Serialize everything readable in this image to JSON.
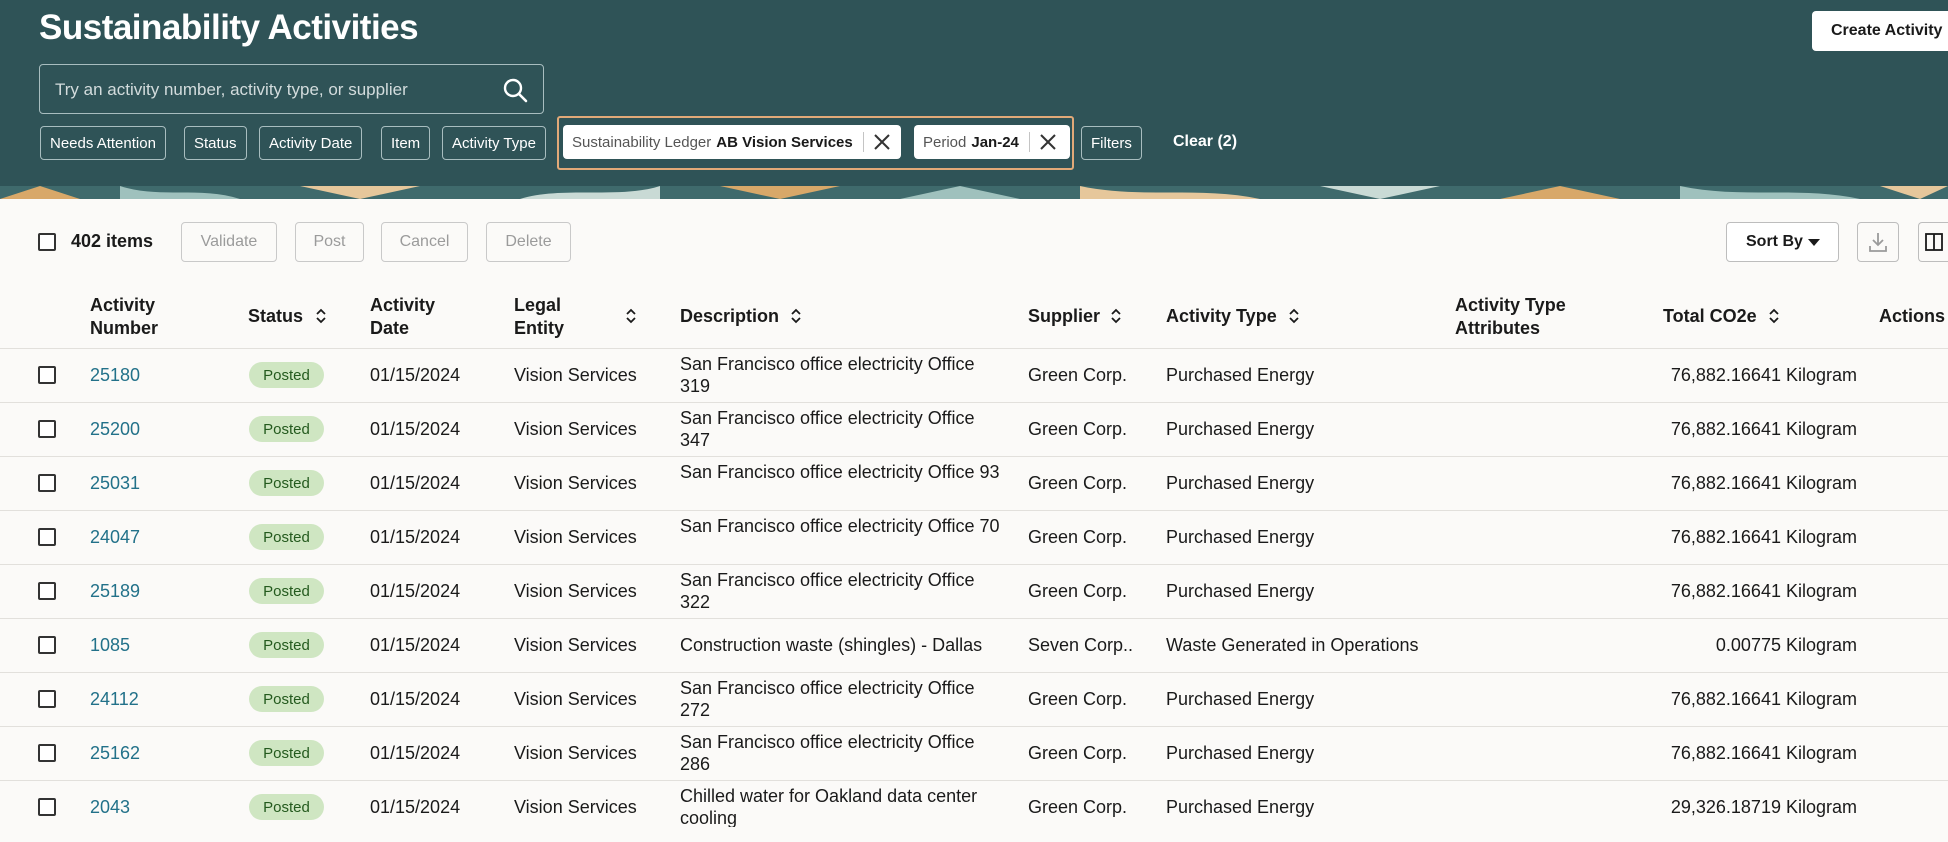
{
  "header": {
    "title": "Sustainability Activities",
    "create_button": "Create Activity",
    "search_placeholder": "Try an activity number, activity type, or supplier",
    "filter_chips": [
      "Needs Attention",
      "Status",
      "Activity Date",
      "Item",
      "Activity Type"
    ],
    "applied_filters": [
      {
        "label": "Sustainability Ledger",
        "value": "AB Vision Services"
      },
      {
        "label": "Period",
        "value": "Jan-24"
      }
    ],
    "filters_button": "Filters",
    "clear_link": "Clear (2)"
  },
  "toolbar": {
    "items_count": "402 items",
    "validate": "Validate",
    "post": "Post",
    "cancel": "Cancel",
    "delete": "Delete",
    "sort_by": "Sort By"
  },
  "table": {
    "columns": {
      "activity_number": "Activity Number",
      "status": "Status",
      "activity_date": "Activity Date",
      "legal_entity": "Legal Entity",
      "description": "Description",
      "supplier": "Supplier",
      "activity_type": "Activity Type",
      "activity_type_attributes": "Activity Type Attributes",
      "total_co2e": "Total CO2e",
      "actions": "Actions"
    },
    "rows": [
      {
        "number": "25180",
        "status": "Posted",
        "date": "01/15/2024",
        "entity": "Vision Services",
        "description": "San Francisco office electricity Office 319",
        "supplier": "Green Corp.",
        "type": "Purchased Energy",
        "co2e": "76,882.16641 Kilogram"
      },
      {
        "number": "25200",
        "status": "Posted",
        "date": "01/15/2024",
        "entity": "Vision Services",
        "description": "San Francisco office electricity Office 347",
        "supplier": "Green Corp.",
        "type": "Purchased Energy",
        "co2e": "76,882.16641 Kilogram"
      },
      {
        "number": "25031",
        "status": "Posted",
        "date": "01/15/2024",
        "entity": "Vision Services",
        "description": "San Francisco office electricity Office 93",
        "supplier": "Green Corp.",
        "type": "Purchased Energy",
        "co2e": "76,882.16641 Kilogram"
      },
      {
        "number": "24047",
        "status": "Posted",
        "date": "01/15/2024",
        "entity": "Vision Services",
        "description": "San Francisco office electricity Office 70",
        "supplier": "Green Corp.",
        "type": "Purchased Energy",
        "co2e": "76,882.16641 Kilogram"
      },
      {
        "number": "25189",
        "status": "Posted",
        "date": "01/15/2024",
        "entity": "Vision Services",
        "description": "San Francisco office electricity Office 322",
        "supplier": "Green Corp.",
        "type": "Purchased Energy",
        "co2e": "76,882.16641 Kilogram"
      },
      {
        "number": "1085",
        "status": "Posted",
        "date": "01/15/2024",
        "entity": "Vision Services",
        "description": "Construction waste (shingles) - Dallas",
        "supplier": "Seven Corp..",
        "type": "Waste Generated in Operations",
        "co2e": "0.00775 Kilogram"
      },
      {
        "number": "24112",
        "status": "Posted",
        "date": "01/15/2024",
        "entity": "Vision Services",
        "description": "San Francisco office electricity Office 272",
        "supplier": "Green Corp.",
        "type": "Purchased Energy",
        "co2e": "76,882.16641 Kilogram"
      },
      {
        "number": "25162",
        "status": "Posted",
        "date": "01/15/2024",
        "entity": "Vision Services",
        "description": "San Francisco office electricity Office 286",
        "supplier": "Green Corp.",
        "type": "Purchased Energy",
        "co2e": "76,882.16641 Kilogram"
      },
      {
        "number": "2043",
        "status": "Posted",
        "date": "01/15/2024",
        "entity": "Vision Services",
        "description": "Chilled water for Oakland data center cooling",
        "supplier": "Green Corp.",
        "type": "Purchased Energy",
        "co2e": "29,326.18719 Kilogram"
      }
    ]
  }
}
